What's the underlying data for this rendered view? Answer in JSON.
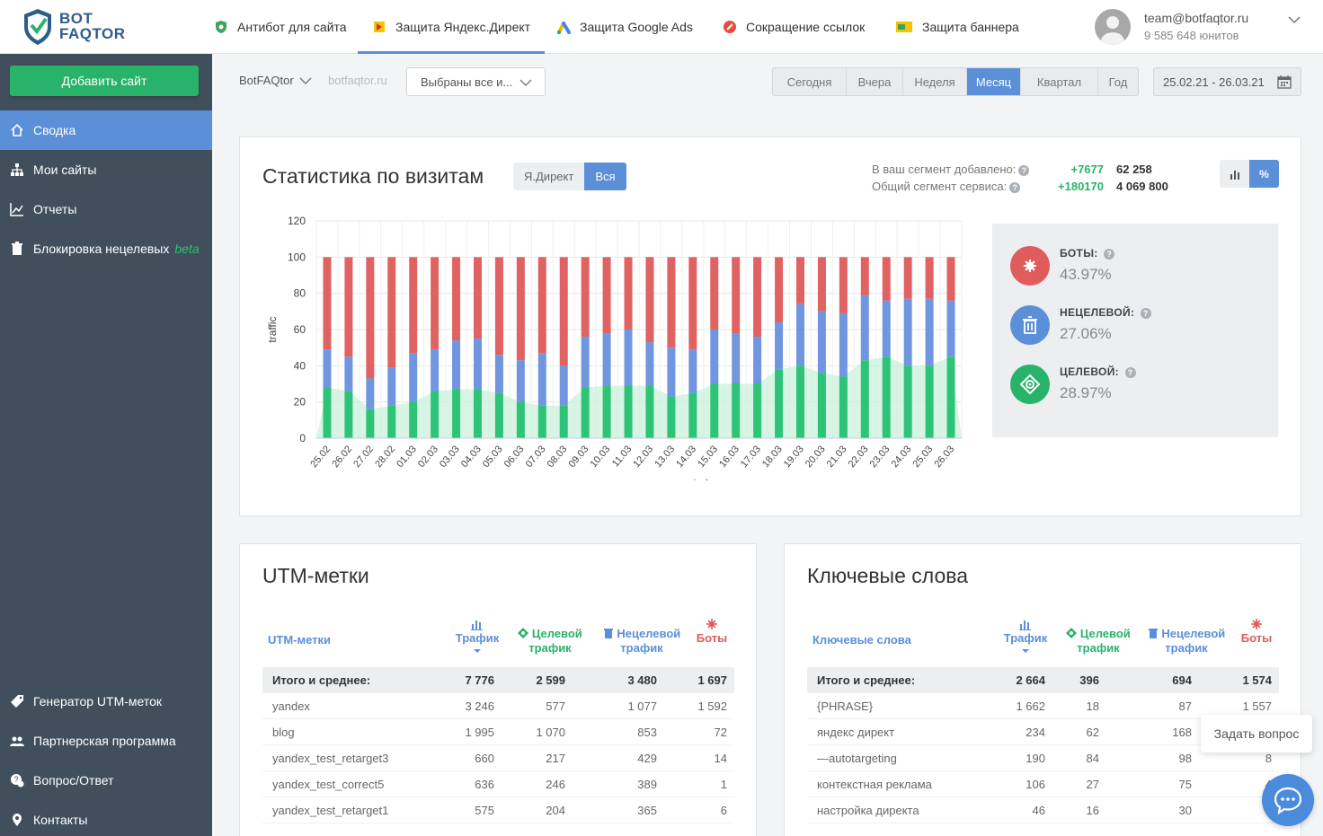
{
  "brand": {
    "line1": "BOT",
    "line2": "FAQTOR"
  },
  "topnav": [
    {
      "label": "Антибот для сайта",
      "icon": "shield-icon",
      "active": false
    },
    {
      "label": "Защита Яндекс.Директ",
      "icon": "yandex-direct-icon",
      "active": true
    },
    {
      "label": "Защита Google Ads",
      "icon": "google-ads-icon",
      "active": false
    },
    {
      "label": "Сокращение ссылок",
      "icon": "link-icon",
      "active": false
    },
    {
      "label": "Защита баннера",
      "icon": "banner-icon",
      "active": false
    }
  ],
  "user": {
    "email": "team@botfaqtor.ru",
    "units": "9 585 648 юнитов"
  },
  "sidebar": {
    "add_button": "Добавить сайт",
    "items": [
      {
        "label": "Сводка",
        "icon": "home-icon",
        "active": true
      },
      {
        "label": "Мои сайты",
        "icon": "sitemap-icon"
      },
      {
        "label": "Отчеты",
        "icon": "chart-line-icon"
      },
      {
        "label": "Блокировка нецелевых",
        "icon": "trash-icon",
        "badge": "beta"
      }
    ],
    "bottom_items": [
      {
        "label": "Генератор UTM-меток",
        "icon": "tag-icon"
      },
      {
        "label": "Партнерская программа",
        "icon": "users-icon"
      },
      {
        "label": "Вопрос/Ответ",
        "icon": "question-chat-icon"
      },
      {
        "label": "Контакты",
        "icon": "map-pin-icon"
      }
    ]
  },
  "filters": {
    "account": "BotFAQtor",
    "domain": "botfaqtor.ru",
    "segments": "Выбраны все и...",
    "periods": [
      "Сегодня",
      "Вчера",
      "Неделя",
      "Месяц",
      "Квартал",
      "Год"
    ],
    "active_period": "Месяц",
    "date_range": "25.02.21 - 26.03.21"
  },
  "stats": {
    "title": "Статистика по визитам",
    "source_tabs": [
      "Я.Директ",
      "Вся"
    ],
    "active_source": "Вся",
    "segment_added_label": "В ваш сегмент добавлено:",
    "segment_total_label": "Общий сегмент сервиса:",
    "segment_added_delta": "+7677",
    "segment_added_total": "62 258",
    "service_delta": "+180170",
    "service_total": "4 069 800",
    "mode_percent": "%",
    "legend": [
      {
        "label": "БОТЫ:",
        "value": "43.97%",
        "color": "#e05c5c",
        "icon": "bug-icon"
      },
      {
        "label": "НЕЦЕЛЕВОЙ:",
        "value": "27.06%",
        "color": "#5b8fd8",
        "icon": "trash-icon"
      },
      {
        "label": "ЦЕЛЕВОЙ:",
        "value": "28.97%",
        "color": "#29b36a",
        "icon": "target-icon"
      }
    ]
  },
  "chart_data": {
    "type": "bar",
    "stacked": true,
    "xlabel": "period",
    "ylabel": "traffic",
    "ylim": [
      0,
      120
    ],
    "yticks": [
      0,
      20,
      40,
      60,
      80,
      100,
      120
    ],
    "grid": true,
    "categories": [
      "25.02",
      "26.02",
      "27.02",
      "28.02",
      "01.03",
      "02.03",
      "03.03",
      "04.03",
      "05.03",
      "06.03",
      "07.03",
      "08.03",
      "09.03",
      "10.03",
      "11.03",
      "12.03",
      "13.03",
      "14.03",
      "15.03",
      "16.03",
      "17.03",
      "18.03",
      "19.03",
      "20.03",
      "21.03",
      "22.03",
      "23.03",
      "24.03",
      "25.03",
      "26.03"
    ],
    "series": [
      {
        "name": "ЦЕЛЕВОЙ",
        "color": "#2ec477",
        "values": [
          28,
          26,
          16,
          18,
          20,
          26,
          27,
          27,
          25,
          20,
          18,
          18,
          28,
          29,
          29,
          29,
          23,
          25,
          30,
          30,
          30,
          38,
          40,
          36,
          34,
          43,
          45,
          40,
          40,
          45
        ]
      },
      {
        "name": "НЕЦЕЛЕВОЙ",
        "color": "#6f96de",
        "values": [
          21,
          19,
          17,
          21,
          27,
          23,
          27,
          28,
          21,
          23,
          29,
          22,
          28,
          29,
          31,
          24,
          27,
          24,
          30,
          28,
          26,
          26,
          34,
          34,
          35,
          36,
          31,
          37,
          37,
          31
        ]
      },
      {
        "name": "БОТЫ",
        "color": "#e06262",
        "values": [
          51,
          55,
          67,
          61,
          53,
          51,
          46,
          45,
          54,
          57,
          53,
          60,
          44,
          42,
          40,
          47,
          50,
          51,
          40,
          42,
          44,
          36,
          26,
          30,
          31,
          21,
          24,
          23,
          23,
          24
        ]
      }
    ]
  },
  "utm": {
    "title": "UTM-метки",
    "headers": [
      "UTM-метки",
      "Трафик",
      "Целевой трафик",
      "Нецелевой трафик",
      "Боты"
    ],
    "total": [
      "Итого и среднее:",
      "7 776",
      "2 599",
      "3 480",
      "1 697"
    ],
    "rows": [
      [
        "yandex",
        "3 246",
        "577",
        "1 077",
        "1 592"
      ],
      [
        "blog",
        "1 995",
        "1 070",
        "853",
        "72"
      ],
      [
        "yandex_test_retarget3",
        "660",
        "217",
        "429",
        "14"
      ],
      [
        "yandex_test_correct5",
        "636",
        "246",
        "389",
        "1"
      ],
      [
        "yandex_test_retarget1",
        "575",
        "204",
        "365",
        "6"
      ]
    ]
  },
  "keywords": {
    "title": "Ключевые слова",
    "headers": [
      "Ключевые слова",
      "Трафик",
      "Целевой трафик",
      "Нецелевой трафик",
      "Боты"
    ],
    "total": [
      "Итого и среднее:",
      "2 664",
      "396",
      "694",
      "1 574"
    ],
    "rows": [
      [
        "{PHRASE}",
        "1 662",
        "18",
        "87",
        "1 557"
      ],
      [
        "яндекс директ",
        "234",
        "62",
        "168",
        "8"
      ],
      [
        "—autotargeting",
        "190",
        "84",
        "98",
        "8"
      ],
      [
        "контекстная реклама",
        "106",
        "27",
        "75",
        "4"
      ],
      [
        "настройка директа",
        "46",
        "16",
        "30",
        "0"
      ]
    ]
  },
  "chat": {
    "tooltip": "Задать вопрос"
  }
}
